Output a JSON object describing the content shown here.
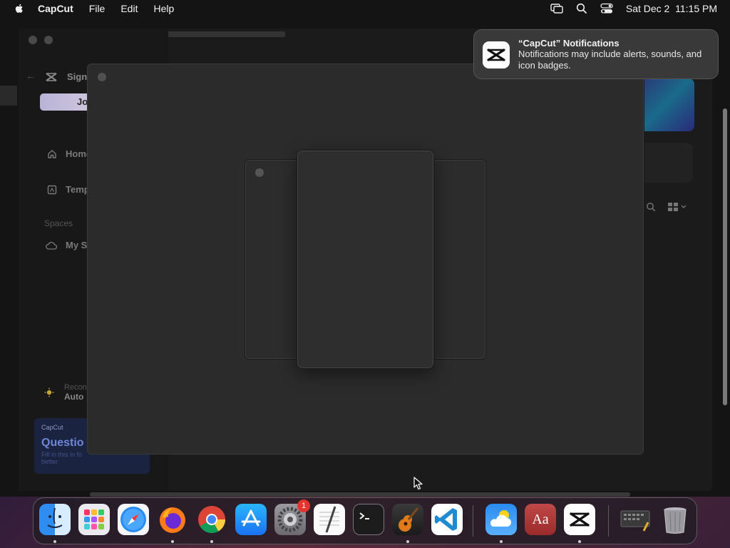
{
  "menubar": {
    "app_name": "CapCut",
    "menus": [
      "File",
      "Edit",
      "Help"
    ],
    "datetime": "Sat Dec 2  11:15 PM"
  },
  "sidebar": {
    "sign_label": "Sign",
    "join_label": "Jo",
    "nav_home": "Home",
    "nav_templates": "Temp",
    "section_spaces": "Spaces",
    "nav_myspace": "My Sp",
    "rec_line1": "Recon",
    "rec_line2": "Auto",
    "promo_brand": "CapCut",
    "promo_title": "Questio",
    "promo_desc1": "Fill in this in fo",
    "promo_desc2": "better"
  },
  "notification": {
    "title": "“CapCut” Notifications",
    "body": "Notifications may include alerts, sounds, and icon badges."
  },
  "dock": {
    "apps": [
      {
        "name": "Finder",
        "icon": "finder-icon"
      },
      {
        "name": "Launchpad",
        "icon": "launchpad-icon"
      },
      {
        "name": "Safari",
        "icon": "safari-icon"
      },
      {
        "name": "Firefox",
        "icon": "firefox-icon"
      },
      {
        "name": "Chrome",
        "icon": "chrome-icon"
      },
      {
        "name": "App Store",
        "icon": "app-store-icon"
      },
      {
        "name": "System Settings",
        "icon": "settings-icon",
        "badge": "1"
      },
      {
        "name": "TextEdit",
        "icon": "textedit-icon"
      },
      {
        "name": "Terminal",
        "icon": "terminal-icon"
      },
      {
        "name": "GarageBand",
        "icon": "garageband-icon"
      },
      {
        "name": "Visual Studio Code",
        "icon": "vscode-icon"
      },
      {
        "name": "Weather",
        "icon": "weather-icon"
      },
      {
        "name": "Dictionary",
        "icon": "dictionary-icon",
        "label": "Aa"
      },
      {
        "name": "CapCut",
        "icon": "capcut-icon"
      },
      {
        "name": "Screenshot",
        "icon": "screenshot-icon"
      },
      {
        "name": "Trash",
        "icon": "trash-icon"
      }
    ]
  },
  "colors": {
    "menubar_bg": "#141414",
    "modal_bg": "#2b2b2b",
    "notification_bg": "#3a3a3a",
    "badge": "#e5342e"
  }
}
